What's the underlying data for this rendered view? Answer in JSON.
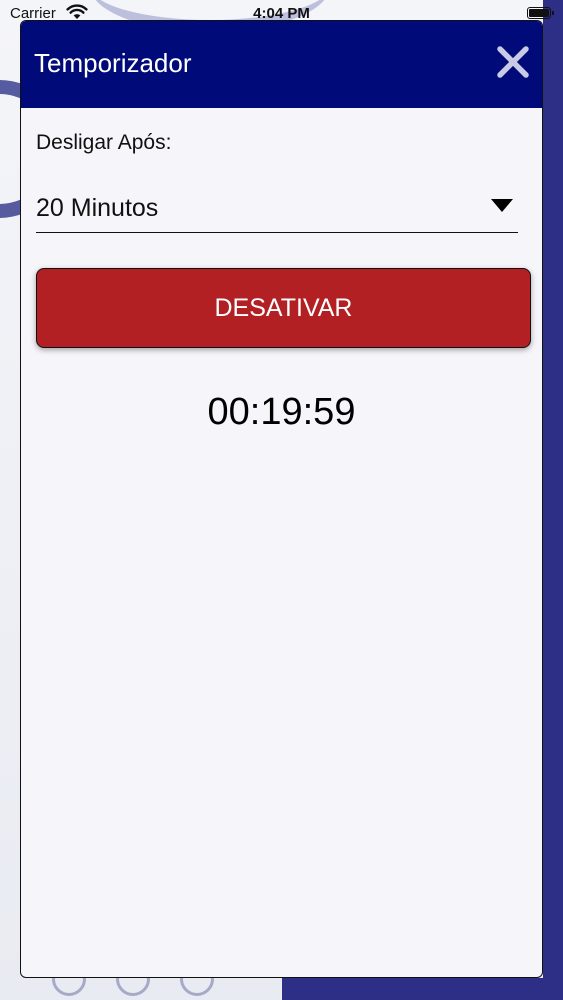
{
  "status_bar": {
    "carrier": "Carrier",
    "time": "4:04 PM"
  },
  "modal": {
    "title": "Temporizador",
    "close_icon": "close-icon",
    "field_label": "Desligar Após:",
    "select_value": "20 Minutos",
    "deactivate_label": "DESATIVAR",
    "countdown": "00:19:59"
  },
  "colors": {
    "header": "#000a78",
    "button": "#b22024",
    "modal_background": "#f5f5fa",
    "close_icon": "#c9cbe6"
  }
}
